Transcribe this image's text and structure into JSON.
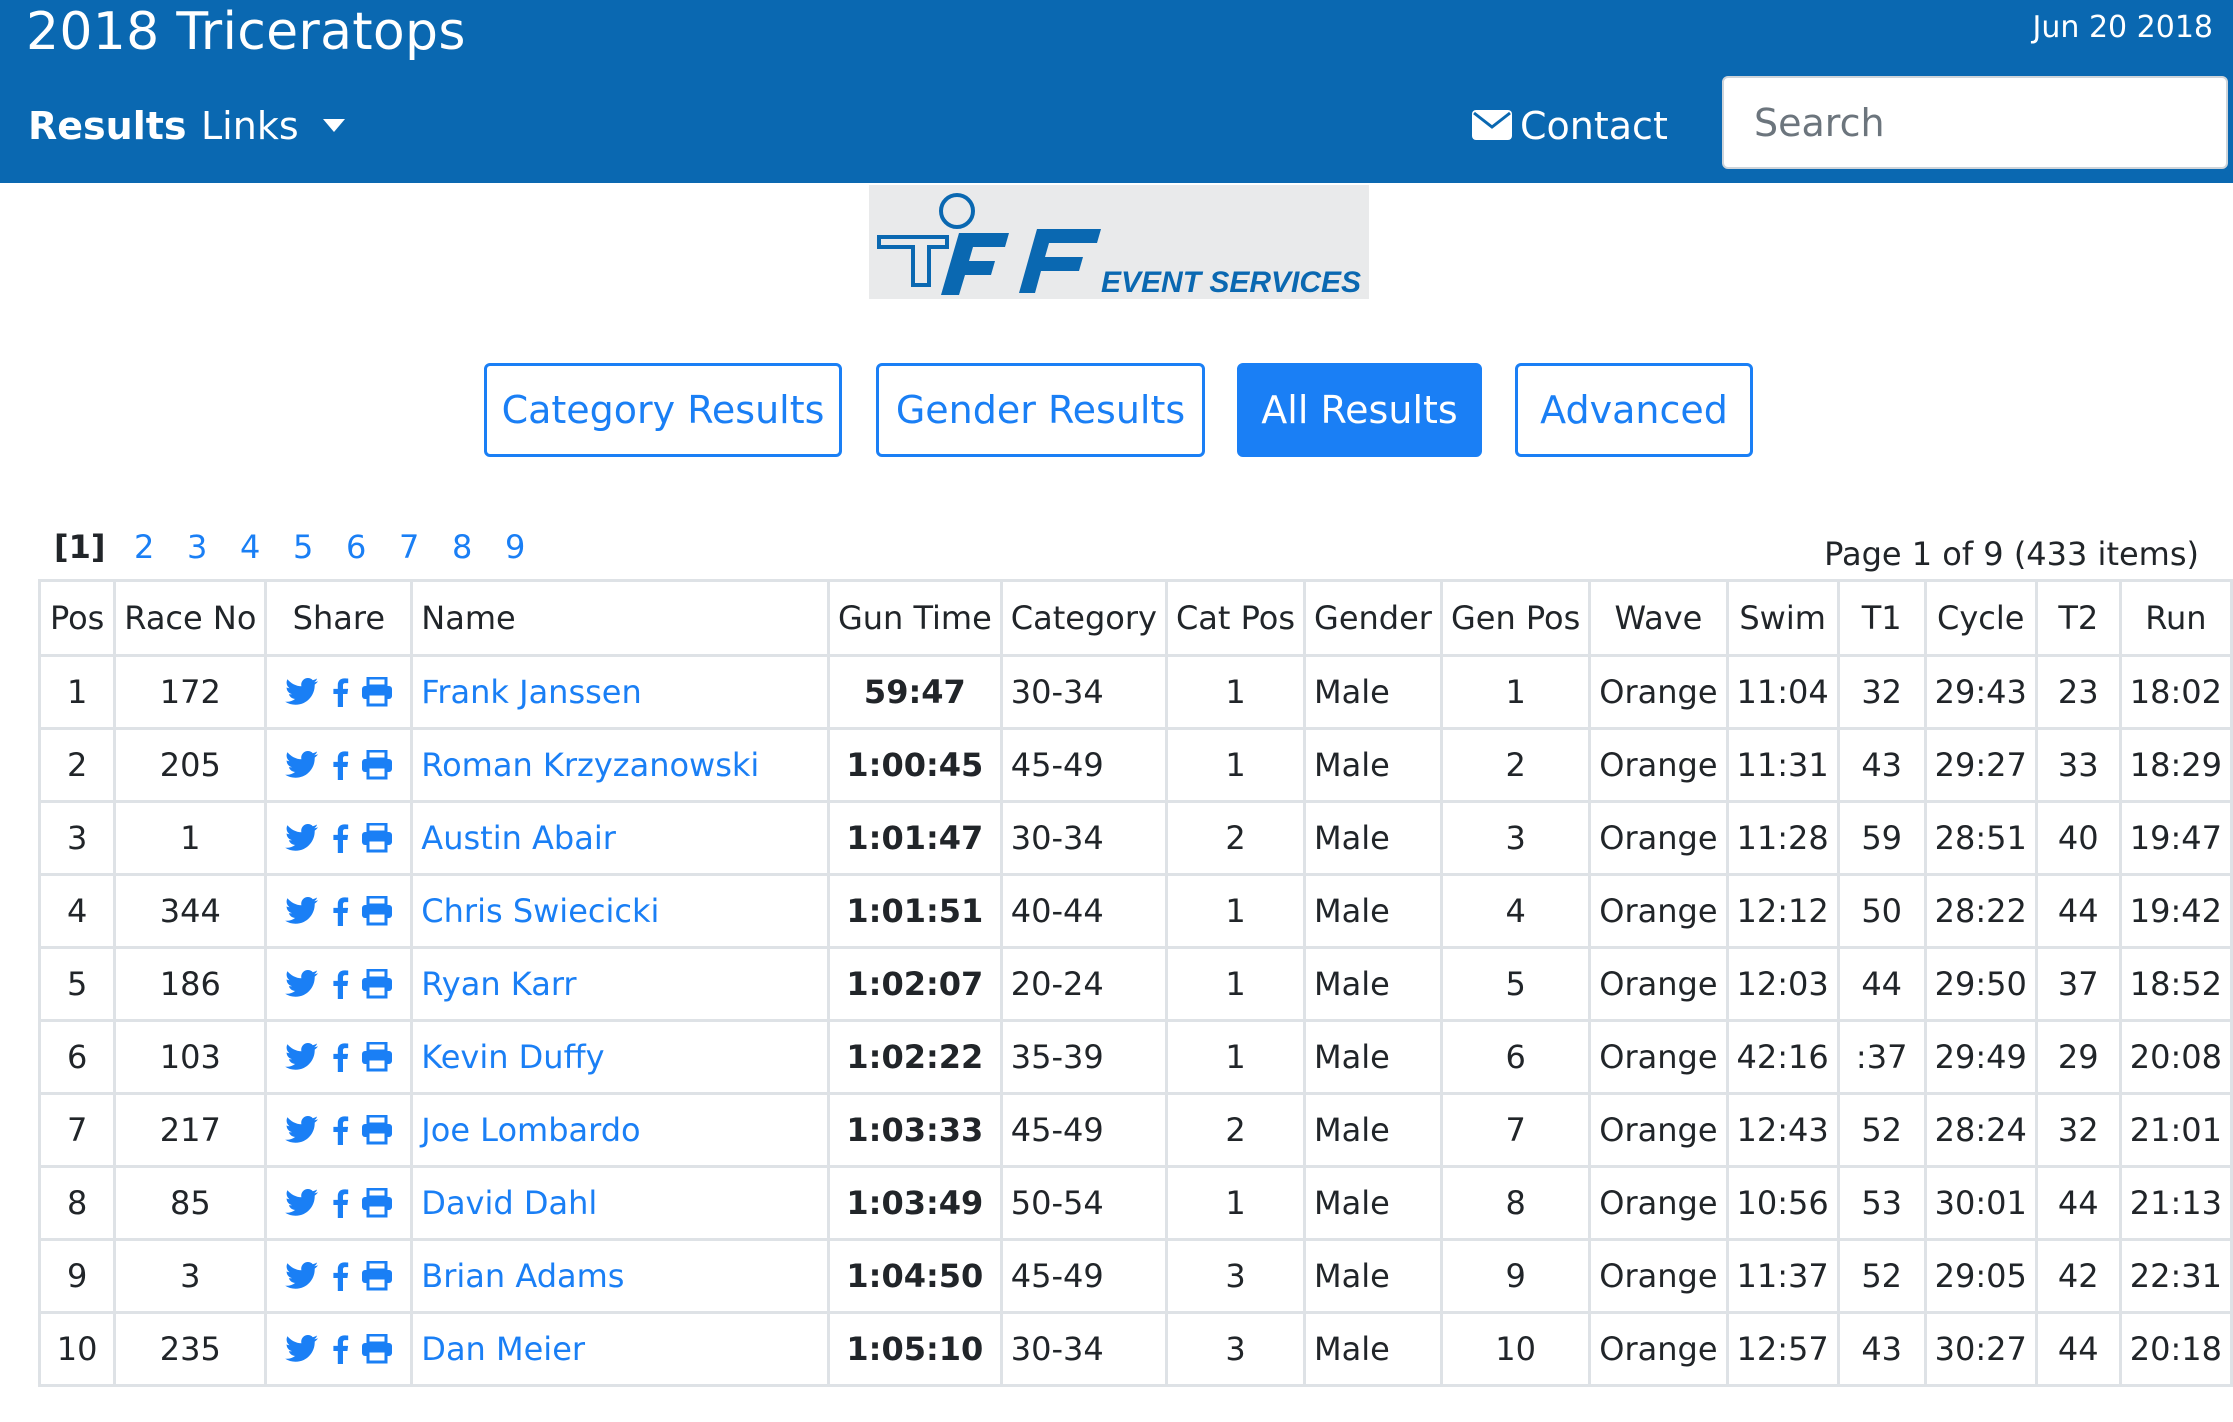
{
  "header": {
    "title": "2018 Triceratops",
    "date": "Jun 20 2018",
    "nav_results": "Results",
    "nav_links": "Links",
    "nav_contact": "Contact",
    "search_placeholder": "Search"
  },
  "logo": {
    "text_main": "rF",
    "text_sub": "EVENT SERVICES",
    "color": "#0a68b1"
  },
  "filters": {
    "category": "Category Results",
    "gender": "Gender Results",
    "all": "All Results",
    "advanced": "Advanced",
    "active": "all"
  },
  "pagination": {
    "current": "[1]",
    "pages": [
      "2",
      "3",
      "4",
      "5",
      "6",
      "7",
      "8",
      "9"
    ],
    "summary": "Page 1 of 9 (433 items)"
  },
  "table": {
    "columns": [
      "Pos",
      "Race No",
      "Share",
      "Name",
      "Gun Time",
      "Category",
      "Cat Pos",
      "Gender",
      "Gen Pos",
      "Wave",
      "Swim",
      "T1",
      "Cycle",
      "T2",
      "Run"
    ],
    "rows": [
      {
        "pos": "1",
        "race_no": "172",
        "name": "Frank Janssen",
        "gun_time": "59:47",
        "category": "30-34",
        "cat_pos": "1",
        "gender": "Male",
        "gen_pos": "1",
        "wave": "Orange",
        "swim": "11:04",
        "t1": "32",
        "cycle": "29:43",
        "t2": "23",
        "run": "18:02"
      },
      {
        "pos": "2",
        "race_no": "205",
        "name": "Roman Krzyzanowski",
        "gun_time": "1:00:45",
        "category": "45-49",
        "cat_pos": "1",
        "gender": "Male",
        "gen_pos": "2",
        "wave": "Orange",
        "swim": "11:31",
        "t1": "43",
        "cycle": "29:27",
        "t2": "33",
        "run": "18:29"
      },
      {
        "pos": "3",
        "race_no": "1",
        "name": "Austin Abair",
        "gun_time": "1:01:47",
        "category": "30-34",
        "cat_pos": "2",
        "gender": "Male",
        "gen_pos": "3",
        "wave": "Orange",
        "swim": "11:28",
        "t1": "59",
        "cycle": "28:51",
        "t2": "40",
        "run": "19:47"
      },
      {
        "pos": "4",
        "race_no": "344",
        "name": "Chris Swiecicki",
        "gun_time": "1:01:51",
        "category": "40-44",
        "cat_pos": "1",
        "gender": "Male",
        "gen_pos": "4",
        "wave": "Orange",
        "swim": "12:12",
        "t1": "50",
        "cycle": "28:22",
        "t2": "44",
        "run": "19:42"
      },
      {
        "pos": "5",
        "race_no": "186",
        "name": "Ryan Karr",
        "gun_time": "1:02:07",
        "category": "20-24",
        "cat_pos": "1",
        "gender": "Male",
        "gen_pos": "5",
        "wave": "Orange",
        "swim": "12:03",
        "t1": "44",
        "cycle": "29:50",
        "t2": "37",
        "run": "18:52"
      },
      {
        "pos": "6",
        "race_no": "103",
        "name": "Kevin Duffy",
        "gun_time": "1:02:22",
        "category": "35-39",
        "cat_pos": "1",
        "gender": "Male",
        "gen_pos": "6",
        "wave": "Orange",
        "swim": "42:16",
        "t1": ":37",
        "cycle": "29:49",
        "t2": "29",
        "run": "20:08"
      },
      {
        "pos": "7",
        "race_no": "217",
        "name": "Joe Lombardo",
        "gun_time": "1:03:33",
        "category": "45-49",
        "cat_pos": "2",
        "gender": "Male",
        "gen_pos": "7",
        "wave": "Orange",
        "swim": "12:43",
        "t1": "52",
        "cycle": "28:24",
        "t2": "32",
        "run": "21:01"
      },
      {
        "pos": "8",
        "race_no": "85",
        "name": "David Dahl",
        "gun_time": "1:03:49",
        "category": "50-54",
        "cat_pos": "1",
        "gender": "Male",
        "gen_pos": "8",
        "wave": "Orange",
        "swim": "10:56",
        "t1": "53",
        "cycle": "30:01",
        "t2": "44",
        "run": "21:13"
      },
      {
        "pos": "9",
        "race_no": "3",
        "name": "Brian Adams",
        "gun_time": "1:04:50",
        "category": "45-49",
        "cat_pos": "3",
        "gender": "Male",
        "gen_pos": "9",
        "wave": "Orange",
        "swim": "11:37",
        "t1": "52",
        "cycle": "29:05",
        "t2": "42",
        "run": "22:31"
      },
      {
        "pos": "10",
        "race_no": "235",
        "name": "Dan Meier",
        "gun_time": "1:05:10",
        "category": "30-34",
        "cat_pos": "3",
        "gender": "Male",
        "gen_pos": "10",
        "wave": "Orange",
        "swim": "12:57",
        "t1": "43",
        "cycle": "30:27",
        "t2": "44",
        "run": "20:18"
      }
    ]
  },
  "colors": {
    "header_bg": "#0a68b1",
    "accent": "#1a7ff5",
    "border": "#dee2e6"
  },
  "share_icons": [
    "twitter-icon",
    "facebook-icon",
    "print-icon"
  ]
}
